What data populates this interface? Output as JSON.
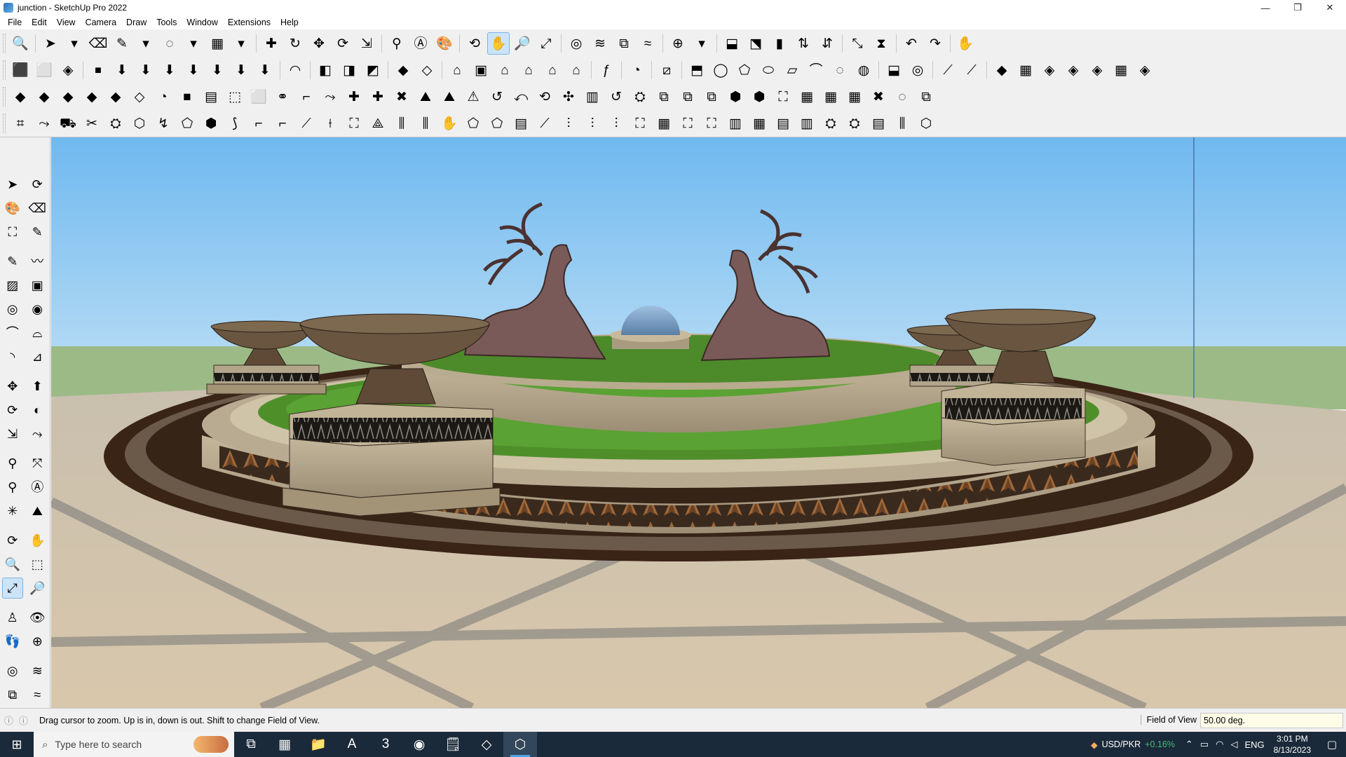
{
  "window": {
    "title": "junction - SketchUp Pro 2022",
    "minimize": "—",
    "restore": "❐",
    "close": "✕"
  },
  "menu": [
    "File",
    "Edit",
    "View",
    "Camera",
    "Draw",
    "Tools",
    "Window",
    "Extensions",
    "Help"
  ],
  "toolbar_rows": [
    [
      "🔍",
      "|",
      "➤",
      "▾",
      "⌫",
      "✎",
      "▾",
      "◌",
      "▾",
      "▦",
      "▾",
      "|",
      "✚",
      "↻",
      "✥",
      "⟳",
      "⇲",
      "|",
      "⚲",
      "Ⓐ",
      "🎨",
      "|",
      "⟲",
      "✋",
      "🔎",
      "⤢",
      "|",
      "◎",
      "≋",
      "⧉",
      "≈",
      "|",
      "⊕",
      "▾",
      "|",
      "⬓",
      "⬔",
      "▮",
      "⇅",
      "⇵",
      "|",
      "⤡",
      "⧗",
      "|",
      "↶",
      "↷",
      "|",
      "✋"
    ],
    [
      "⬛",
      "⬜",
      "◈",
      "|",
      "⏹",
      "⬇",
      "⬇",
      "⬇",
      "⬇",
      "⬇",
      "⬇",
      "⬇",
      "|",
      "◠",
      "|",
      "◧",
      "◨",
      "◩",
      "|",
      "◆",
      "◇",
      "|",
      "⌂",
      "▣",
      "⌂",
      "⌂",
      "⌂",
      "⌂",
      "|",
      "ƒ",
      "|",
      "◔",
      "|",
      "⧄",
      "|",
      "⬒",
      "◯",
      "⬠",
      "⬭",
      "▱",
      "⌒",
      "◌",
      "◍",
      "|",
      "⬓",
      "◎",
      "|",
      "⟋",
      "⟋",
      "|",
      "◆",
      "▦",
      "◈",
      "◈",
      "◈",
      "▦",
      "◈"
    ],
    [
      "◆",
      "◆",
      "◆",
      "◆",
      "◆",
      "◇",
      "◔",
      "■",
      "▤",
      "⬚",
      "⬜",
      "⚭",
      "⌐",
      "⤳",
      "✚",
      "✚",
      "✖",
      "⛰",
      "⛰",
      "⚠",
      "↺",
      "⤺",
      "⟲",
      "✣",
      "▥",
      "↺",
      "⛭",
      "⧉",
      "⧉",
      "⧉",
      "⬢",
      "⬢",
      "⛶",
      "▦",
      "▦",
      "▦",
      "✖",
      "◌",
      "⧉"
    ],
    [
      "⌗",
      "⤳",
      "⛟",
      "✂",
      "⛭",
      "⬡",
      "↯",
      "⬠",
      "⬢",
      "⟆",
      "⌐",
      "⌐",
      "⟋",
      "⟊",
      "⛶",
      "⟁",
      "⫼",
      "⫼",
      "✋",
      "⬠",
      "⬠",
      "▤",
      "⟋",
      "⫶",
      "⫶",
      "⫶",
      "⛶",
      "▦",
      "⛶",
      "⛶",
      "▥",
      "▦",
      "▤",
      "▥",
      "⛭",
      "⛭",
      "▤",
      "⫼",
      "⬡"
    ]
  ],
  "left_tools": [
    [
      "➤",
      "⟳"
    ],
    [
      "🎨",
      "⌫"
    ],
    [
      "⛶",
      "✎"
    ],
    null,
    [
      "✎",
      "〰"
    ],
    [
      "▨",
      "▣"
    ],
    [
      "◎",
      "◉"
    ],
    [
      "⌒",
      "⌓"
    ],
    [
      "◝",
      "⊿"
    ],
    null,
    [
      "✥",
      "⬆"
    ],
    [
      "⟳",
      "◐"
    ],
    [
      "⇲",
      "⤳"
    ],
    null,
    [
      "⚲",
      "⤧"
    ],
    [
      "⚲",
      "Ⓐ"
    ],
    [
      "✳",
      "⛰"
    ],
    null,
    [
      "⟳",
      "✋"
    ],
    [
      "🔍",
      "⬚"
    ],
    [
      "⤢",
      "🔎"
    ],
    null,
    [
      "♙",
      "👁"
    ],
    [
      "👣",
      "⊕"
    ],
    null,
    [
      "◎",
      "≋"
    ],
    [
      "⧉",
      "≈"
    ]
  ],
  "status": {
    "message": "Drag cursor to zoom.  Up is in, down is out. Shift to change Field of View.",
    "vcb_label": "Field of View",
    "vcb_value": "50.00 deg."
  },
  "taskbar": {
    "search_placeholder": "Type here to search",
    "apps": [
      "⧉",
      "▦",
      "📁",
      "A",
      "3",
      "◉",
      "🗒",
      "◇",
      "⬡"
    ],
    "active_app_index": 8,
    "ticker_symbol": "USD/PKR",
    "ticker_change": "+0.16%",
    "language": "ENG",
    "time": "3:01 PM",
    "date": "8/13/2023"
  },
  "colors": {
    "sky_top": "#6fb9f0",
    "sky_bottom": "#b8dcf4",
    "ground": "#9cba86",
    "fountain_stone": "#b3a58c",
    "grass": "#4f8f2a",
    "statue": "#7a5a58",
    "taskbar": "#1b2a3a"
  }
}
